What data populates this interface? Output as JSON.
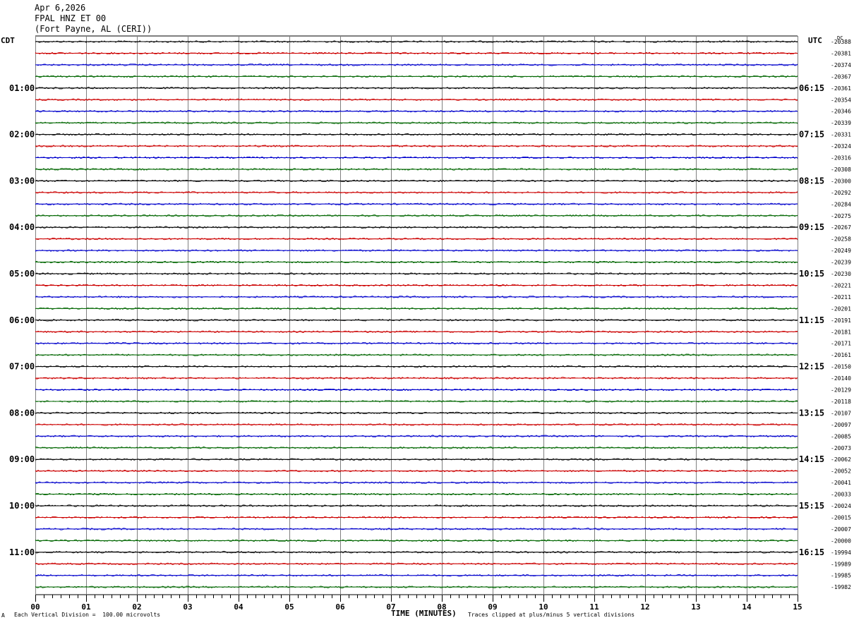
{
  "header": {
    "date": "Apr 6,2026",
    "station": "FPAL HNZ ET 00",
    "location": "(Fort Payne, AL (CERI))"
  },
  "chart_data": {
    "type": "line",
    "title": "",
    "xlabel": "TIME (MINUTES)",
    "left_timezone": "CDT",
    "right_timezone": "UTC",
    "dc_label": "DC",
    "x_ticks": [
      "00",
      "01",
      "02",
      "03",
      "04",
      "05",
      "06",
      "07",
      "08",
      "09",
      "10",
      "11",
      "12",
      "13",
      "14",
      "15"
    ],
    "xlim": [
      0,
      15
    ],
    "left_hour_labels": [
      "01:00",
      "02:00",
      "03:00",
      "04:00",
      "05:00",
      "06:00",
      "07:00",
      "08:00",
      "09:00",
      "10:00",
      "11:00"
    ],
    "right_hour_labels": [
      "06:15",
      "07:15",
      "08:15",
      "09:15",
      "10:15",
      "11:15",
      "12:15",
      "13:15",
      "14:15",
      "15:15",
      "16:15"
    ],
    "dc_offsets": [
      "-20388",
      "-20381",
      "-20374",
      "-20367",
      "-20361",
      "-20354",
      "-20346",
      "-20339",
      "-20331",
      "-20324",
      "-20316",
      "-20308",
      "-20300",
      "-20292",
      "-20284",
      "-20275",
      "-20267",
      "-20258",
      "-20249",
      "-20239",
      "-20230",
      "-20221",
      "-20211",
      "-20201",
      "-20191",
      "-20181",
      "-20171",
      "-20161",
      "-20150",
      "-20140",
      "-20129",
      "-20118",
      "-20107",
      "-20097",
      "-20085",
      "-20073",
      "-20062",
      "-20052",
      "-20041",
      "-20033",
      "-20024",
      "-20015",
      "-20007",
      "-20000",
      "-19994",
      "-19989",
      "-19985",
      "-19982"
    ],
    "trace_colors": [
      "#000000",
      "#cc0000",
      "#0000cc",
      "#006600"
    ],
    "grid": true,
    "footer_scale": "Each Vertical Division =  100.00 microvolts",
    "footer_clip": "Traces clipped at plus/minus 5 vertical divisions",
    "corner_mark": "A"
  }
}
